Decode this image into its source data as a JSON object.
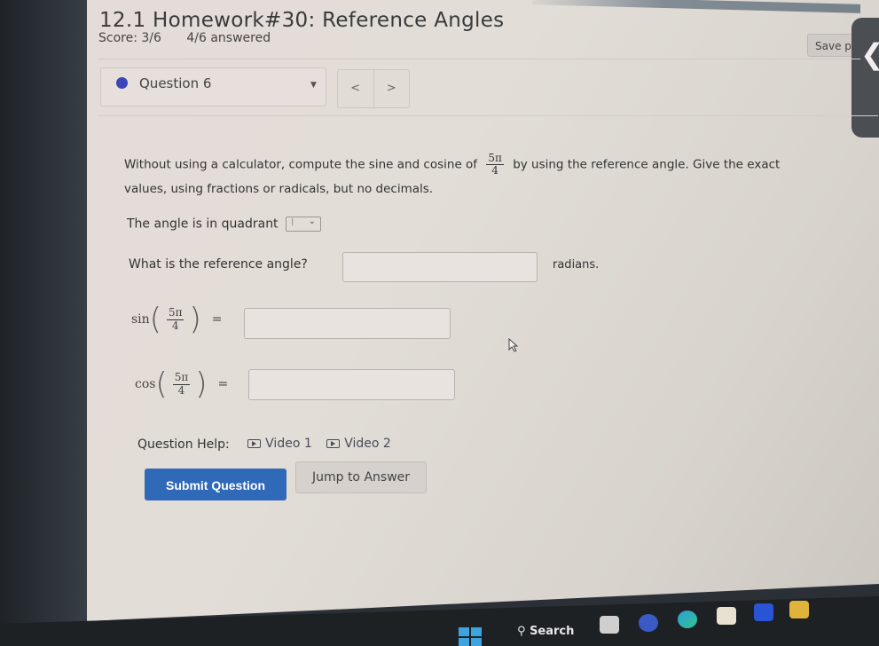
{
  "page": {
    "title": "12.1 Homework#30: Reference Angles",
    "score": "Score: 3/6",
    "answered": "4/6 answered",
    "save_label": "Save p",
    "side_tab_icon": "chevron-left-icon"
  },
  "question_nav": {
    "current": "Question 6",
    "status_color": "#3b45b6",
    "prev_label": "<",
    "next_label": ">"
  },
  "question": {
    "prompt_before": "Without using a calculator, compute the sine and cosine of",
    "angle_num": "5π",
    "angle_den": "4",
    "prompt_after": "by using the reference angle. Give the exact",
    "prompt_line2": "values, using fractions or radicals, but no decimals.",
    "quadrant_label": "The angle is in quadrant",
    "quadrant_value": "I",
    "reference_label": "What is the reference angle?",
    "reference_value": "",
    "reference_unit": "radians.",
    "sin_fn": "sin",
    "cos_fn": "cos",
    "equals": "=",
    "sin_value": "",
    "cos_value": ""
  },
  "help": {
    "label": "Question Help:",
    "videos": [
      "Video 1",
      "Video 2"
    ]
  },
  "actions": {
    "submit_label": "Submit Question",
    "submit_color": "#3069b8",
    "jump_label": "Jump to Answer"
  },
  "taskbar": {
    "search_label": "Search",
    "apps": [
      "task-view",
      "meet",
      "edge",
      "store",
      "dropbox",
      "file-explorer"
    ]
  }
}
